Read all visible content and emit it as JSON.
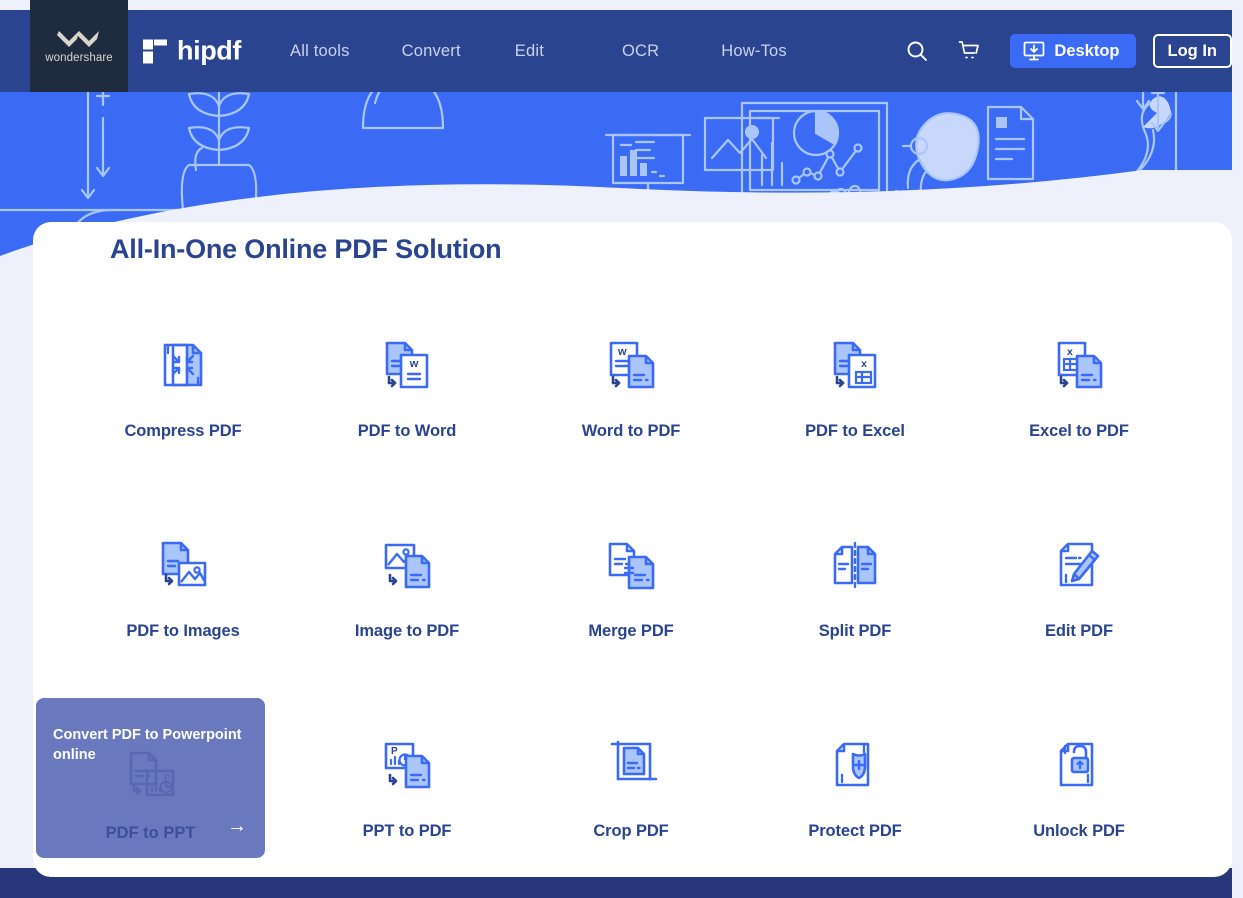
{
  "brand": {
    "company": "wondershare",
    "product": "hipdf",
    "logo_mark": "wondershare-w-mark",
    "product_mark": "hipdf-flag-mark"
  },
  "nav": {
    "links": [
      {
        "label": "All tools",
        "name": "nav-link-all-tools"
      },
      {
        "label": "Convert",
        "name": "nav-link-convert"
      },
      {
        "label": "Edit",
        "name": "nav-link-edit"
      },
      {
        "label": "OCR",
        "name": "nav-link-ocr"
      },
      {
        "label": "How-Tos",
        "name": "nav-link-how-tos"
      }
    ],
    "search_icon": "search-icon",
    "cart_icon": "cart-icon",
    "desktop_button": "Desktop",
    "desktop_icon": "download-to-monitor-icon",
    "login_button": "Log In"
  },
  "hero": {
    "illustration": "person-at-desk-with-charts-line-art"
  },
  "main": {
    "title": "All-In-One Online PDF Solution",
    "tools": [
      {
        "label": "Compress PDF",
        "icon": "compress-pdf-icon"
      },
      {
        "label": "PDF to Word",
        "icon": "pdf-to-word-icon"
      },
      {
        "label": "Word to PDF",
        "icon": "word-to-pdf-icon"
      },
      {
        "label": "PDF to Excel",
        "icon": "pdf-to-excel-icon"
      },
      {
        "label": "Excel to PDF",
        "icon": "excel-to-pdf-icon"
      },
      {
        "label": "PDF to Images",
        "icon": "pdf-to-images-icon"
      },
      {
        "label": "Image to PDF",
        "icon": "image-to-pdf-icon"
      },
      {
        "label": "Merge PDF",
        "icon": "merge-pdf-icon"
      },
      {
        "label": "Split PDF",
        "icon": "split-pdf-icon"
      },
      {
        "label": "Edit PDF",
        "icon": "edit-pdf-icon"
      },
      {
        "label": "PDF to PPT",
        "icon": "pdf-to-ppt-icon"
      },
      {
        "label": "PPT to PDF",
        "icon": "ppt-to-pdf-icon"
      },
      {
        "label": "Crop PDF",
        "icon": "crop-pdf-icon"
      },
      {
        "label": "Protect PDF",
        "icon": "protect-pdf-icon"
      },
      {
        "label": "Unlock PDF",
        "icon": "unlock-pdf-icon"
      }
    ]
  },
  "hover_card": {
    "description": "Convert PDF to Powerpoint online",
    "label": "PDF to PPT",
    "arrow_icon": "arrow-right-icon",
    "icon": "pdf-to-ppt-icon"
  },
  "colors": {
    "nav_blue": "#2b4490",
    "hero_blue": "#3b6bf5",
    "page_bg": "#eef1fb",
    "footer_band": "#283779",
    "title_navy": "#2b4490",
    "icon_blue": "#3b6bf5",
    "icon_fill": "#a9c5fa",
    "hover_tile": "#6a79bd",
    "brand_dark": "#1f2c3f"
  }
}
